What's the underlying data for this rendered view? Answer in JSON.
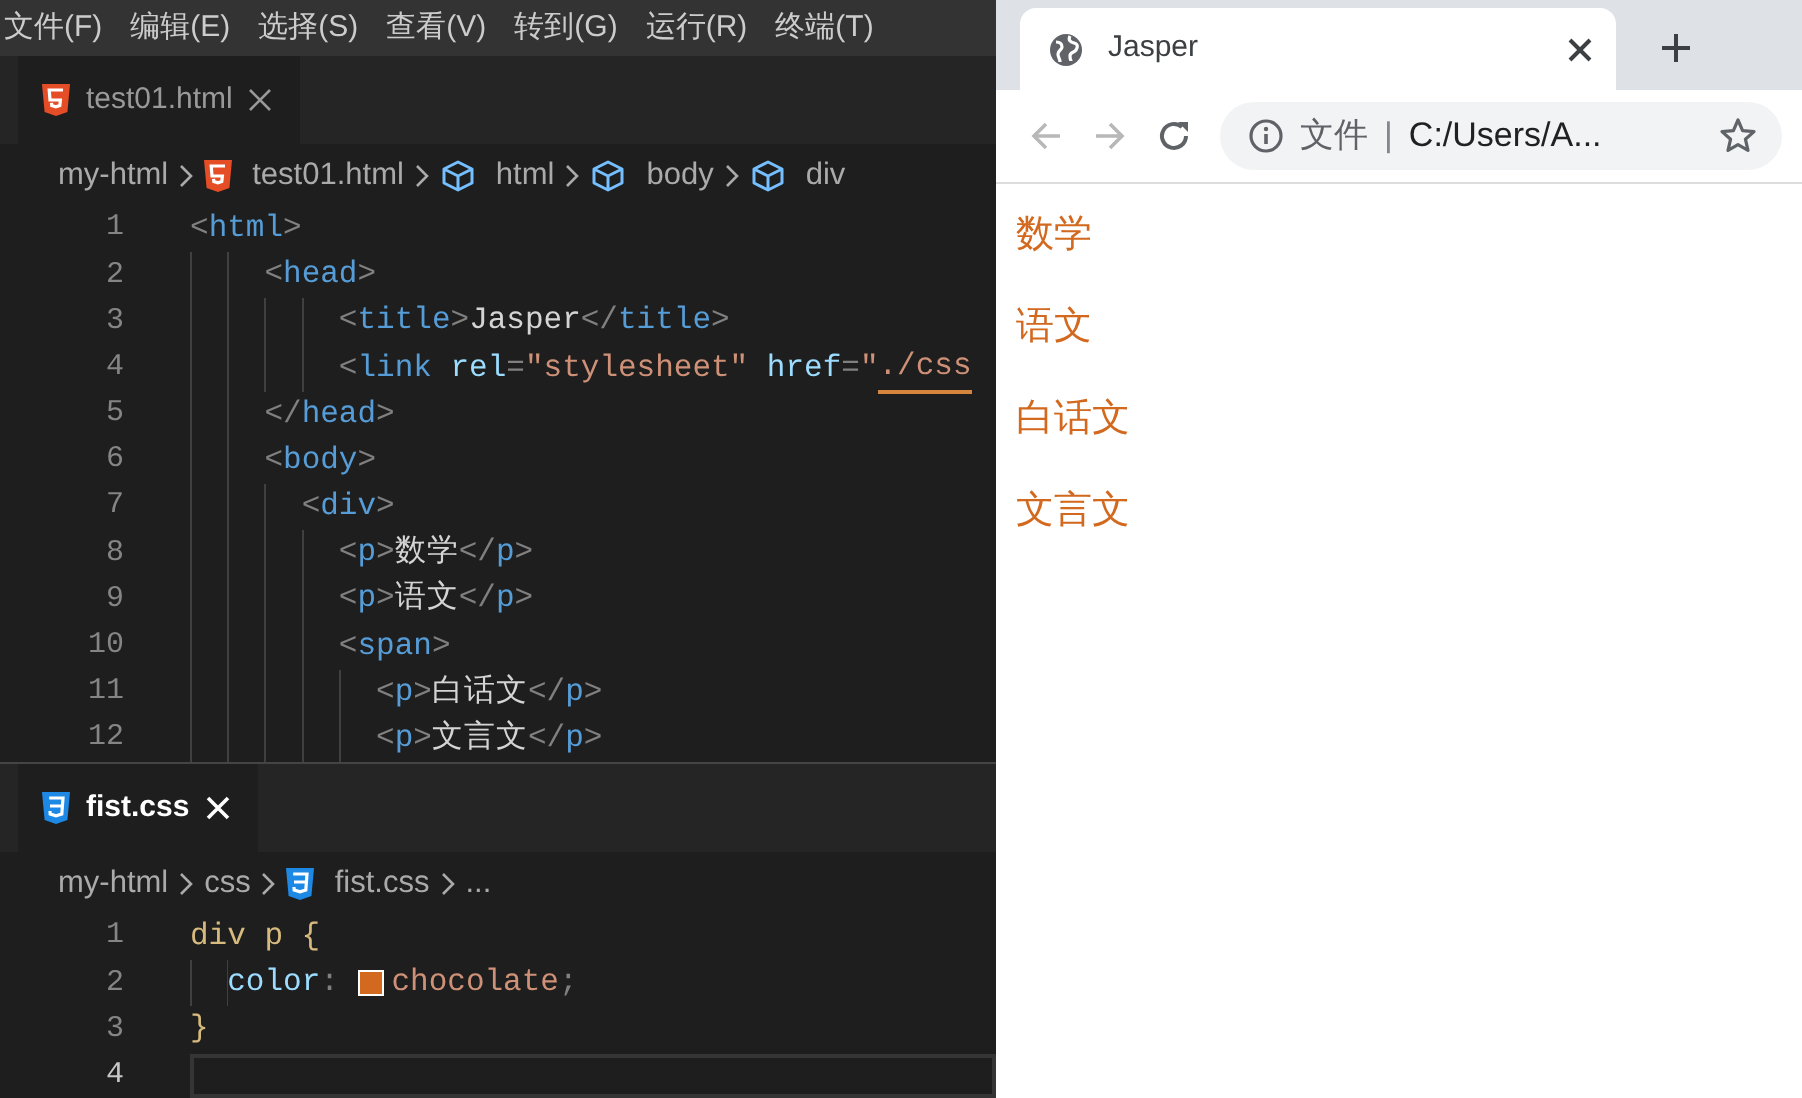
{
  "menu_bar": {
    "items": [
      "文件(F)",
      "编辑(E)",
      "选择(S)",
      "查看(V)",
      "转到(G)",
      "运行(R)",
      "终端(T)"
    ]
  },
  "editor_groups": [
    {
      "focused": false,
      "tab": {
        "label": "test01.html",
        "kind": "html"
      },
      "breadcrumbs": [
        {
          "kind": "folder",
          "text": "my-html"
        },
        {
          "kind": "html",
          "text": "test01.html"
        },
        {
          "kind": "element",
          "text": "html"
        },
        {
          "kind": "element",
          "text": "body"
        },
        {
          "kind": "element",
          "text": "div"
        }
      ],
      "lines": [
        {
          "number": "1",
          "tokens": [
            {
              "kind": "punct",
              "text": "<"
            },
            {
              "kind": "tag",
              "text": "html"
            },
            {
              "kind": "punct",
              "text": ">"
            }
          ]
        },
        {
          "number": "2",
          "tokens": [
            {
              "kind": "punct",
              "text": "    <"
            },
            {
              "kind": "tag",
              "text": "head"
            },
            {
              "kind": "punct",
              "text": ">"
            }
          ]
        },
        {
          "number": "3",
          "tokens": [
            {
              "kind": "punct",
              "text": "        <"
            },
            {
              "kind": "tag",
              "text": "title"
            },
            {
              "kind": "punct",
              "text": ">"
            },
            {
              "kind": "text",
              "text": "Jasper"
            },
            {
              "kind": "punct",
              "text": "</"
            },
            {
              "kind": "tag",
              "text": "title"
            },
            {
              "kind": "punct",
              "text": ">"
            }
          ]
        },
        {
          "number": "4",
          "tokens": [
            {
              "kind": "punct",
              "text": "        <"
            },
            {
              "kind": "tag",
              "text": "link"
            },
            {
              "kind": "attr",
              "text": " rel"
            },
            {
              "kind": "punct",
              "text": "="
            },
            {
              "kind": "string",
              "text": "\"stylesheet\""
            },
            {
              "kind": "attr",
              "text": " href"
            },
            {
              "kind": "punct",
              "text": "="
            },
            {
              "kind": "string",
              "text": "\""
            },
            {
              "kind": "string",
              "text": "./css",
              "underlined": true
            }
          ]
        },
        {
          "number": "5",
          "tokens": [
            {
              "kind": "punct",
              "text": "    </"
            },
            {
              "kind": "tag",
              "text": "head"
            },
            {
              "kind": "punct",
              "text": ">"
            }
          ]
        },
        {
          "number": "6",
          "tokens": [
            {
              "kind": "punct",
              "text": "    <"
            },
            {
              "kind": "tag",
              "text": "body"
            },
            {
              "kind": "punct",
              "text": ">"
            }
          ]
        },
        {
          "number": "7",
          "tokens": [
            {
              "kind": "punct",
              "text": "      <"
            },
            {
              "kind": "tag",
              "text": "div"
            },
            {
              "kind": "punct",
              "text": ">"
            }
          ]
        },
        {
          "number": "8",
          "tokens": [
            {
              "kind": "punct",
              "text": "        <"
            },
            {
              "kind": "tag",
              "text": "p"
            },
            {
              "kind": "punct",
              "text": ">"
            },
            {
              "kind": "text",
              "text": "数学"
            },
            {
              "kind": "punct",
              "text": "</"
            },
            {
              "kind": "tag",
              "text": "p"
            },
            {
              "kind": "punct",
              "text": ">"
            }
          ]
        },
        {
          "number": "9",
          "tokens": [
            {
              "kind": "punct",
              "text": "        <"
            },
            {
              "kind": "tag",
              "text": "p"
            },
            {
              "kind": "punct",
              "text": ">"
            },
            {
              "kind": "text",
              "text": "语文"
            },
            {
              "kind": "punct",
              "text": "</"
            },
            {
              "kind": "tag",
              "text": "p"
            },
            {
              "kind": "punct",
              "text": ">"
            }
          ]
        },
        {
          "number": "10",
          "tokens": [
            {
              "kind": "punct",
              "text": "        <"
            },
            {
              "kind": "tag",
              "text": "span"
            },
            {
              "kind": "punct",
              "text": ">"
            }
          ]
        },
        {
          "number": "11",
          "tokens": [
            {
              "kind": "punct",
              "text": "          <"
            },
            {
              "kind": "tag",
              "text": "p"
            },
            {
              "kind": "punct",
              "text": ">"
            },
            {
              "kind": "text",
              "text": "白话文"
            },
            {
              "kind": "punct",
              "text": "</"
            },
            {
              "kind": "tag",
              "text": "p"
            },
            {
              "kind": "punct",
              "text": ">"
            }
          ]
        },
        {
          "number": "12",
          "tokens": [
            {
              "kind": "punct",
              "text": "          <"
            },
            {
              "kind": "tag",
              "text": "p"
            },
            {
              "kind": "punct",
              "text": ">"
            },
            {
              "kind": "text",
              "text": "文言文"
            },
            {
              "kind": "punct",
              "text": "</"
            },
            {
              "kind": "tag",
              "text": "p"
            },
            {
              "kind": "punct",
              "text": ">"
            }
          ]
        }
      ]
    },
    {
      "focused": true,
      "tab": {
        "label": "fist.css",
        "kind": "css"
      },
      "breadcrumbs": [
        {
          "kind": "folder",
          "text": "my-html"
        },
        {
          "kind": "folder",
          "text": "css"
        },
        {
          "kind": "css",
          "text": "fist.css"
        },
        {
          "kind": "more",
          "text": "..."
        }
      ],
      "lines": [
        {
          "number": "1",
          "tokens": [
            {
              "kind": "selector",
              "text": "div p {"
            }
          ]
        },
        {
          "number": "2",
          "tokens": [
            {
              "kind": "property",
              "text": "  color"
            },
            {
              "kind": "punct",
              "text": ": "
            },
            {
              "kind": "swatch",
              "color": "#d2691e"
            },
            {
              "kind": "string",
              "text": "chocolate"
            },
            {
              "kind": "punct",
              "text": ";"
            }
          ]
        },
        {
          "number": "3",
          "tokens": [
            {
              "kind": "selector",
              "text": "}"
            }
          ]
        },
        {
          "number": "4",
          "current": true
        }
      ]
    }
  ],
  "browser": {
    "tab": {
      "title": "Jasper"
    },
    "toolbar": {
      "back_disabled": true,
      "forward_disabled": true,
      "scheme_label": "文件",
      "separator": "|",
      "url": "C:/Users/A..."
    },
    "paragraphs": [
      "数学",
      "语文",
      "白话文",
      "文言文"
    ]
  }
}
